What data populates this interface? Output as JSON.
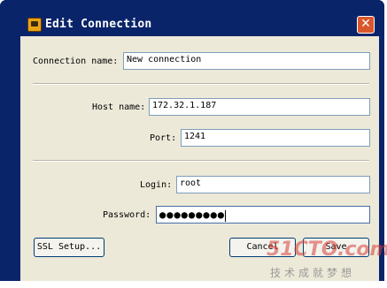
{
  "window": {
    "title": "Edit Connection",
    "close_glyph": "✕"
  },
  "form": {
    "connection_name_label": "Connection name:",
    "connection_name_value": "New connection",
    "host_name_label": "Host name:",
    "host_name_value": "172.32.1.187",
    "port_label": "Port:",
    "port_value": "1241",
    "login_label": "Login:",
    "login_value": "root",
    "password_label": "Password:",
    "password_mask": "●●●●●●●●●"
  },
  "buttons": {
    "ssl_setup": "SSL Setup...",
    "cancel": "Cancel",
    "save": "Save"
  },
  "watermark": {
    "brand": "51CTO.com",
    "slogan": "技术成就梦想"
  },
  "colors": {
    "titlebar": "#0a246a",
    "dialog": "#ece9d8",
    "close": "#d9572c"
  }
}
